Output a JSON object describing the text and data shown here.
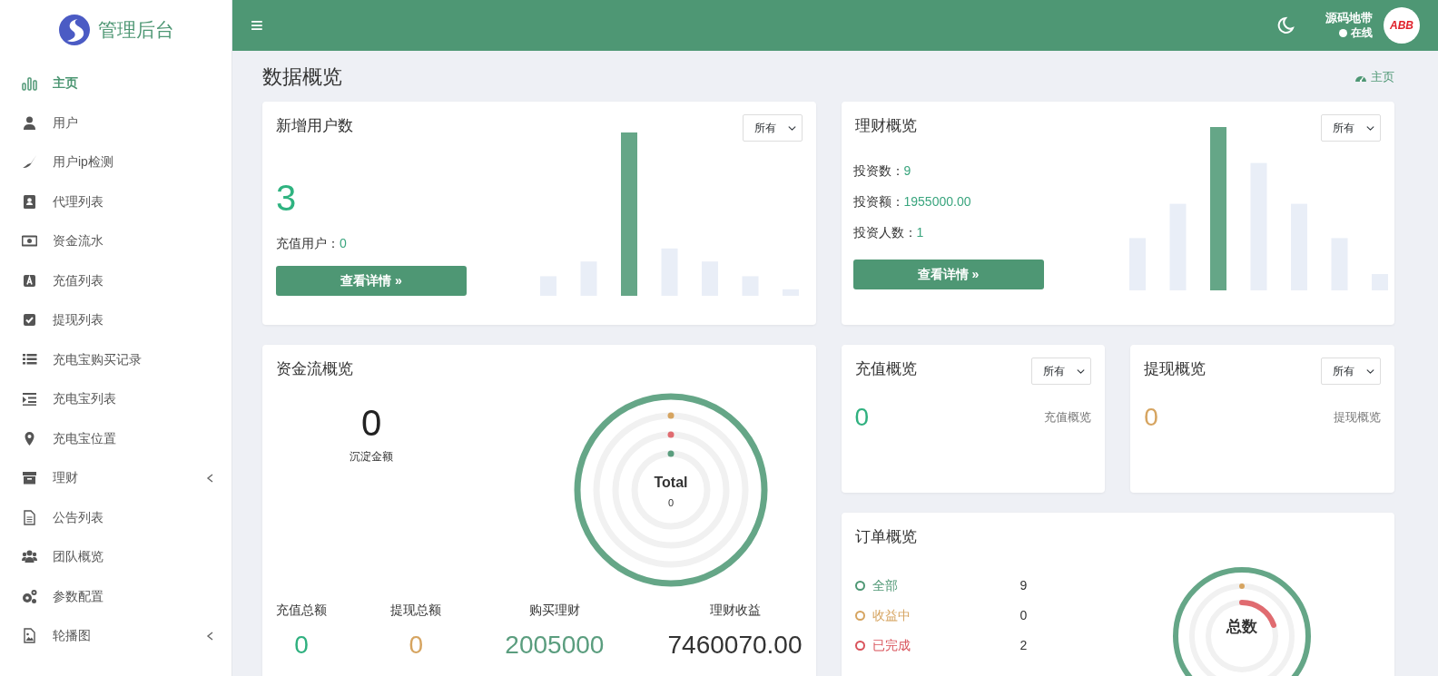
{
  "sidebar": {
    "brand": "管理后台",
    "items": [
      {
        "label": "主页",
        "selected": true,
        "expandable": false
      },
      {
        "label": "用户",
        "selected": false,
        "expandable": false
      },
      {
        "label": "用户ip检测",
        "selected": false,
        "expandable": false
      },
      {
        "label": "代理列表",
        "selected": false,
        "expandable": false
      },
      {
        "label": "资金流水",
        "selected": false,
        "expandable": false
      },
      {
        "label": "充值列表",
        "selected": false,
        "expandable": false
      },
      {
        "label": "提现列表",
        "selected": false,
        "expandable": false
      },
      {
        "label": "充电宝购买记录",
        "selected": false,
        "expandable": false
      },
      {
        "label": "充电宝列表",
        "selected": false,
        "expandable": false
      },
      {
        "label": "充电宝位置",
        "selected": false,
        "expandable": false
      },
      {
        "label": "理财",
        "selected": false,
        "expandable": true
      },
      {
        "label": "公告列表",
        "selected": false,
        "expandable": false
      },
      {
        "label": "团队概览",
        "selected": false,
        "expandable": false
      },
      {
        "label": "参数配置",
        "selected": false,
        "expandable": false
      },
      {
        "label": "轮播图",
        "selected": false,
        "expandable": true
      }
    ]
  },
  "header": {
    "menu_icon": "≡",
    "user": {
      "name": "源码地带",
      "status": "在线",
      "online": true,
      "avatar_text": "ABB"
    }
  },
  "page": {
    "title": "数据概览",
    "breadcrumb": "主页"
  },
  "new_users": {
    "title": "新增用户数",
    "filter": "所有",
    "value": "3",
    "sub_label": "充值用户：",
    "sub_value": "0",
    "button": "查看详情",
    "button_icon": "»"
  },
  "finance": {
    "title": "理财概览",
    "filter": "所有",
    "stats": [
      {
        "label": "投资数：",
        "value": "9"
      },
      {
        "label": "投资额：",
        "value": "1955000.00"
      },
      {
        "label": "投资人数：",
        "value": "1"
      }
    ],
    "button": "查看详情",
    "button_icon": "»"
  },
  "cash_flow": {
    "title": "资金流概览",
    "value": "0",
    "value_label": "沉淀金额",
    "center_title": "Total",
    "center_value": "0",
    "totals": [
      {
        "label": "充值总额",
        "value": "0",
        "color": "#2fb07f"
      },
      {
        "label": "提现总额",
        "value": "0",
        "color": "#d6a460"
      },
      {
        "label": "购买理财",
        "value": "2005000",
        "color": "#5a9d7e"
      },
      {
        "label": "理财收益",
        "value": "7460070.00",
        "color": "#333333"
      }
    ]
  },
  "overview_cards": [
    {
      "title": "充值概览",
      "filter": "所有",
      "value": "0",
      "caption": "充值概览",
      "color": "#2fb07f"
    },
    {
      "title": "提现概览",
      "filter": "所有",
      "value": "0",
      "caption": "提现概览",
      "color": "#d6a460"
    }
  ],
  "orders": {
    "title": "订单概览",
    "center_label": "总数",
    "legend": [
      {
        "label": "全部",
        "count": "9",
        "color": "#4e9774"
      },
      {
        "label": "收益中",
        "count": "0",
        "color": "#d6a460"
      },
      {
        "label": "已完成",
        "count": "2",
        "color": "#d9535b"
      }
    ]
  }
}
